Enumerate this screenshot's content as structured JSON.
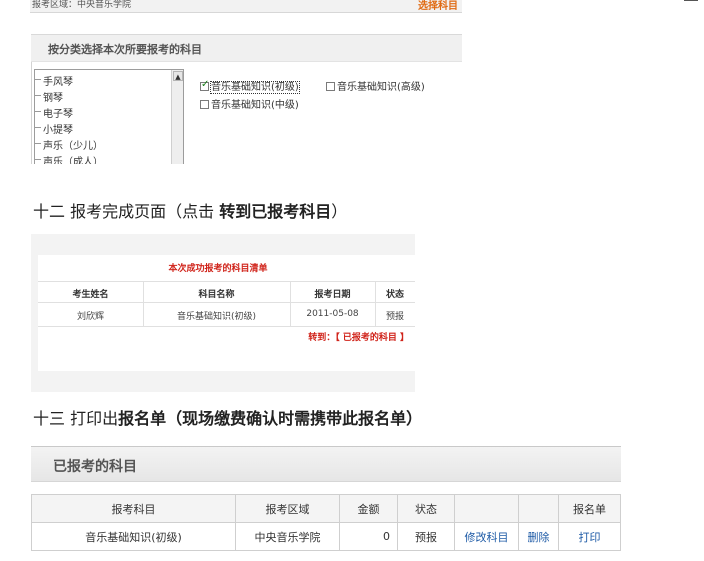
{
  "selection": {
    "region_label": "报考区域：中央音乐学院",
    "choose_link": "选择科目",
    "panel_title": "按分类选择本次所要报考的科目",
    "categories": [
      "手风琴",
      "钢琴",
      "电子琴",
      "小提琴",
      "声乐（少儿）",
      "声乐（成人）"
    ],
    "options": [
      {
        "label": "音乐基础知识(初级)",
        "checked": true
      },
      {
        "label": "音乐基础知识(高级)",
        "checked": false
      },
      {
        "label": "音乐基础知识(中级)",
        "checked": false
      }
    ]
  },
  "step12": {
    "prefix": "十二 报考完成页面（点击 ",
    "bold": "转到已报考科目",
    "suffix": "）"
  },
  "complete": {
    "title": "本次成功报考的科目清单",
    "headers": [
      "考生姓名",
      "科目名称",
      "报考日期",
      "状态"
    ],
    "row": [
      "刘欣辉",
      "音乐基础知识(初级)",
      "2011-05-08",
      "预报"
    ],
    "goto_link": "转到：【 已报考的科目 】"
  },
  "step13": {
    "prefix": "十三 打印出",
    "bold": "报名单（现场缴费确认时需携带此报名单）"
  },
  "registered": {
    "title": "已报考的科目",
    "headers": [
      "报考科目",
      "报考区域",
      "金额",
      "状态",
      "",
      "",
      "报名单"
    ],
    "row": {
      "subject": "音乐基础知识(初级)",
      "region": "中央音乐学院",
      "amount": "0",
      "status": "预报",
      "edit": "修改科目",
      "delete": "删除",
      "print": "打印"
    }
  }
}
